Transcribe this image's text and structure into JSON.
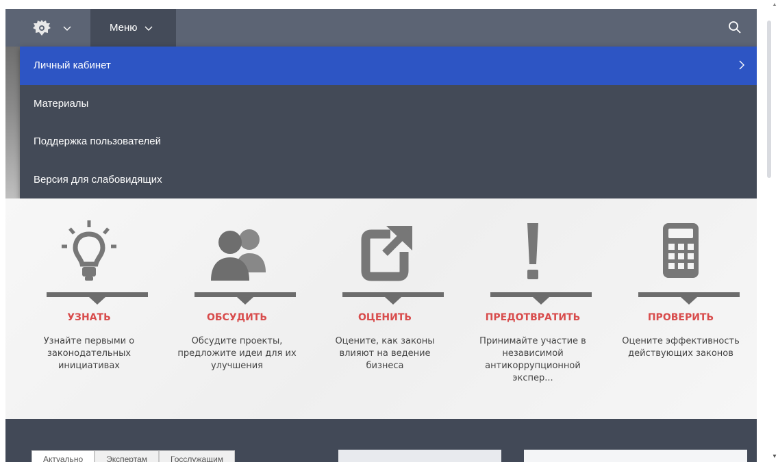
{
  "header": {
    "emblem_icon": "coat-of-arms-icon",
    "menu_label": "Меню",
    "search_icon": "search-icon"
  },
  "dropdown": {
    "items": [
      {
        "label": "Личный кабинет",
        "active": true
      },
      {
        "label": "Материалы"
      },
      {
        "label": "Поддержка пользователей"
      },
      {
        "label": "Версия для слабовидящих"
      }
    ]
  },
  "features": [
    {
      "icon": "lightbulb-icon",
      "title": "УЗНАТЬ",
      "desc": "Узнайте первыми о законодательных инициативах"
    },
    {
      "icon": "people-icon",
      "title": "ОБСУДИТЬ",
      "desc": "Обсудите проекты, предложите идеи для их улучшения"
    },
    {
      "icon": "external-arrow-icon",
      "title": "ОЦЕНИТЬ",
      "desc": "Оцените, как законы влияют на ведение бизнеса"
    },
    {
      "icon": "exclamation-icon",
      "title": "ПРЕДОТВРАТИТЬ",
      "desc": "Принимайте участие в независимой антикоррупционной экспер..."
    },
    {
      "icon": "calculator-icon",
      "title": "ПРОВЕРИТЬ",
      "desc": "Оцените эффективность действующих законов"
    }
  ],
  "bottom": {
    "tabs": [
      "Актуально",
      "Экспертам",
      "Госслужащим"
    ]
  },
  "colors": {
    "accent": "#2d55c4",
    "feature_title": "#d84c4c",
    "header": "#5c6474",
    "dropdown": "#434a57"
  }
}
